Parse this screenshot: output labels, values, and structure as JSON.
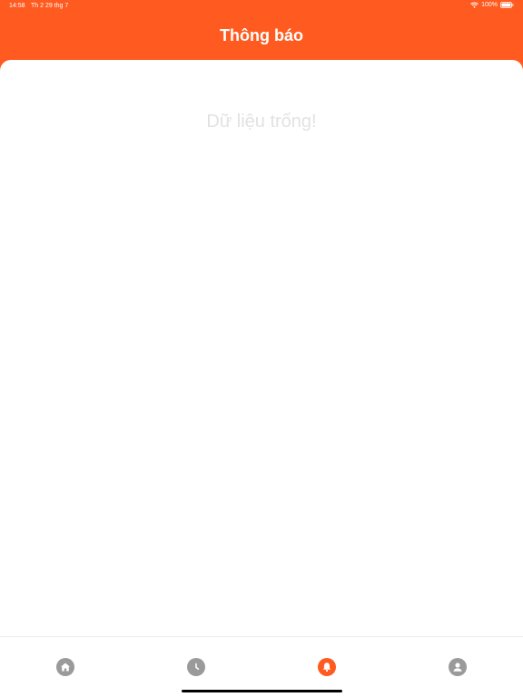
{
  "status_bar": {
    "time": "14:58",
    "date": "Th 2 29 thg 7",
    "battery": "100%"
  },
  "header": {
    "title": "Thông báo"
  },
  "content": {
    "empty_message": "Dữ liệu trống!"
  },
  "tab_bar": {
    "tabs": [
      {
        "icon": "home-icon",
        "active": false
      },
      {
        "icon": "clock-icon",
        "active": false
      },
      {
        "icon": "bell-icon",
        "active": true
      },
      {
        "icon": "user-icon",
        "active": false
      }
    ]
  },
  "colors": {
    "brand": "#FF5A1F",
    "tab_inactive": "#9a9a9a",
    "empty_text": "#e2e2e2"
  }
}
